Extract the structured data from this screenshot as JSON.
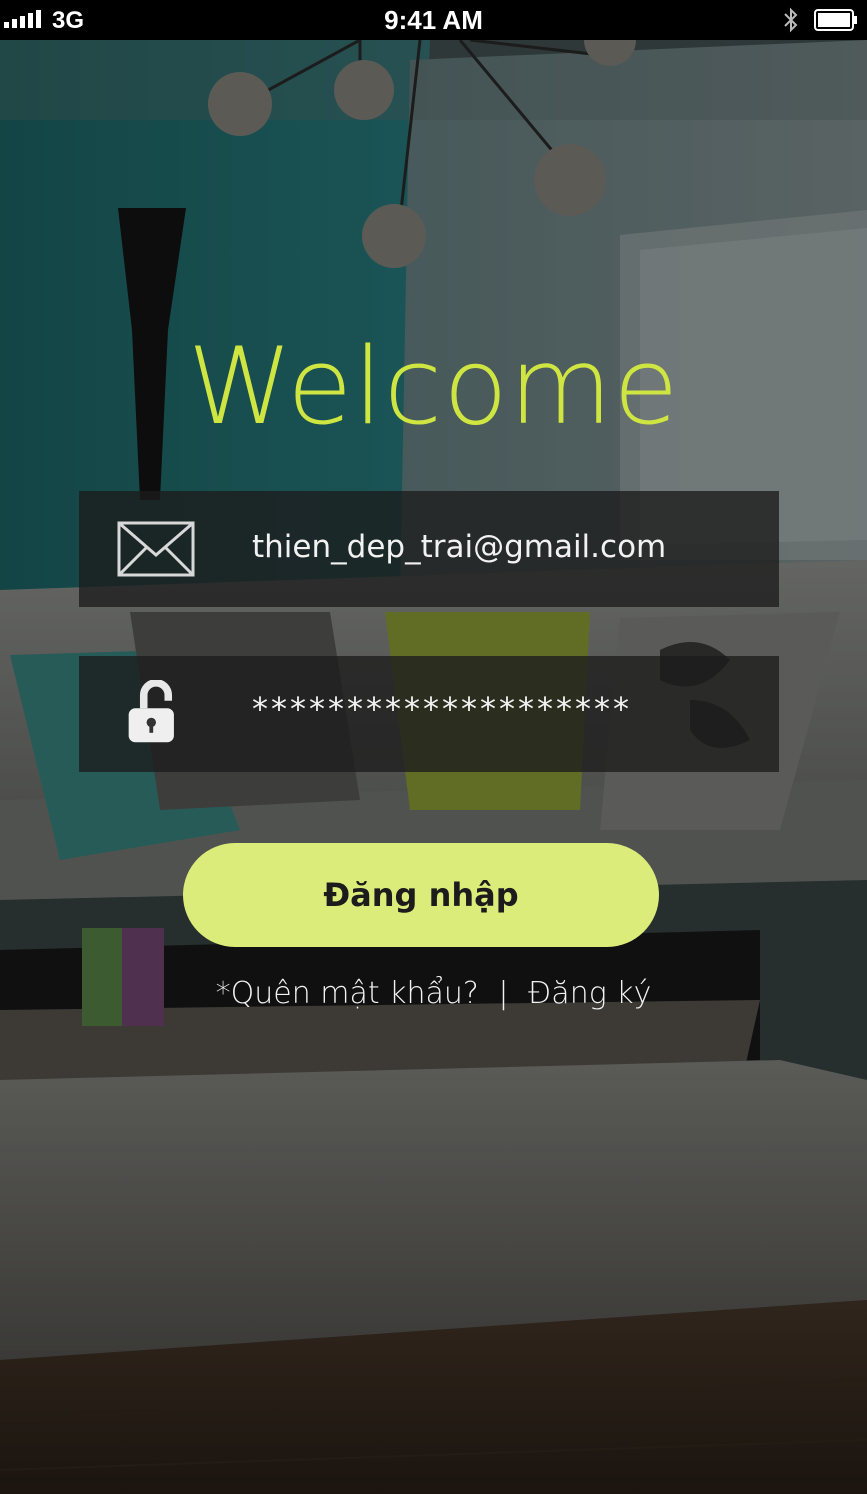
{
  "status_bar": {
    "carrier": "3G",
    "time": "9:41 AM"
  },
  "login": {
    "title": "Welcome",
    "email_value": "thien_dep_trai@gmail.com",
    "password_value": "********************",
    "login_button": "Đăng nhập",
    "forgot_link": "*Quên mật khẩu?",
    "separator": "|",
    "register_link": "Đăng ký"
  },
  "colors": {
    "title": "#cfe642",
    "button": "#dcec7a",
    "field_bg": "#1c1c1c"
  }
}
